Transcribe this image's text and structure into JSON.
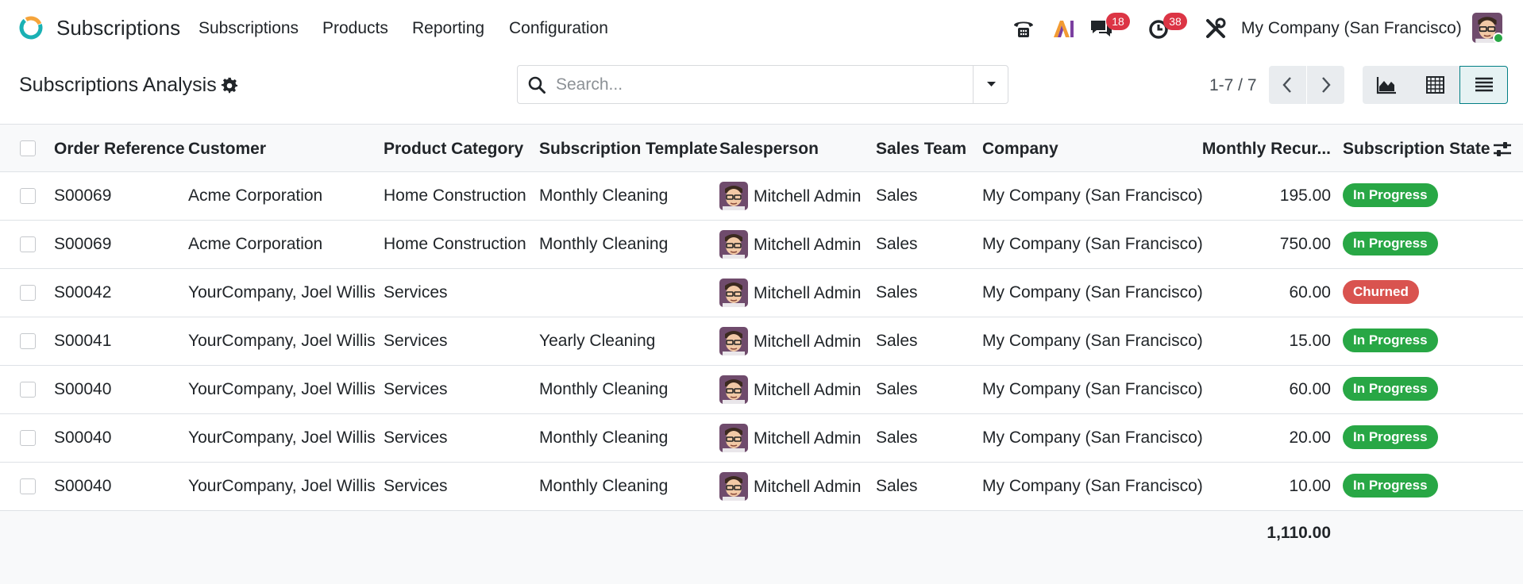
{
  "navbar": {
    "app_name": "Subscriptions",
    "menu": [
      "Subscriptions",
      "Products",
      "Reporting",
      "Configuration"
    ],
    "messages_count": "18",
    "activities_count": "38",
    "company": "My Company (San Francisco)"
  },
  "control_panel": {
    "title": "Subscriptions Analysis",
    "search_placeholder": "Search...",
    "pager": "1-7 / 7"
  },
  "table": {
    "columns": [
      "Order Reference",
      "Customer",
      "Product Category",
      "Subscription Template",
      "Salesperson",
      "Sales Team",
      "Company",
      "Monthly Recur...",
      "Subscription State"
    ],
    "rows": [
      {
        "ref": "S00069",
        "customer": "Acme Corporation",
        "category": "Home Construction",
        "template": "Monthly Cleaning",
        "salesperson": "Mitchell Admin",
        "team": "Sales",
        "company": "My Company (San Francisco)",
        "mrr": "195.00",
        "state": "In Progress"
      },
      {
        "ref": "S00069",
        "customer": "Acme Corporation",
        "category": "Home Construction",
        "template": "Monthly Cleaning",
        "salesperson": "Mitchell Admin",
        "team": "Sales",
        "company": "My Company (San Francisco)",
        "mrr": "750.00",
        "state": "In Progress"
      },
      {
        "ref": "S00042",
        "customer": "YourCompany, Joel Willis",
        "category": "Services",
        "template": "",
        "salesperson": "Mitchell Admin",
        "team": "Sales",
        "company": "My Company (San Francisco)",
        "mrr": "60.00",
        "state": "Churned"
      },
      {
        "ref": "S00041",
        "customer": "YourCompany, Joel Willis",
        "category": "Services",
        "template": "Yearly Cleaning",
        "salesperson": "Mitchell Admin",
        "team": "Sales",
        "company": "My Company (San Francisco)",
        "mrr": "15.00",
        "state": "In Progress"
      },
      {
        "ref": "S00040",
        "customer": "YourCompany, Joel Willis",
        "category": "Services",
        "template": "Monthly Cleaning",
        "salesperson": "Mitchell Admin",
        "team": "Sales",
        "company": "My Company (San Francisco)",
        "mrr": "60.00",
        "state": "In Progress"
      },
      {
        "ref": "S00040",
        "customer": "YourCompany, Joel Willis",
        "category": "Services",
        "template": "Monthly Cleaning",
        "salesperson": "Mitchell Admin",
        "team": "Sales",
        "company": "My Company (San Francisco)",
        "mrr": "20.00",
        "state": "In Progress"
      },
      {
        "ref": "S00040",
        "customer": "YourCompany, Joel Willis",
        "category": "Services",
        "template": "Monthly Cleaning",
        "salesperson": "Mitchell Admin",
        "team": "Sales",
        "company": "My Company (San Francisco)",
        "mrr": "10.00",
        "state": "In Progress"
      }
    ],
    "total_mrr": "1,110.00"
  },
  "colors": {
    "in_progress": "#28a745",
    "churned": "#d9534f",
    "badge": "#dc3545",
    "accent": "#017e84"
  },
  "icons": {
    "logo": "subscriptions-logo-icon",
    "gear": "gear-icon",
    "search": "search-icon",
    "phone": "phone-icon",
    "ai": "ai-icon",
    "chat": "chat-icon",
    "activity": "clock-icon",
    "debug": "tools-icon",
    "graph": "area-chart-icon",
    "pivot": "pivot-table-icon",
    "list": "list-view-icon"
  }
}
